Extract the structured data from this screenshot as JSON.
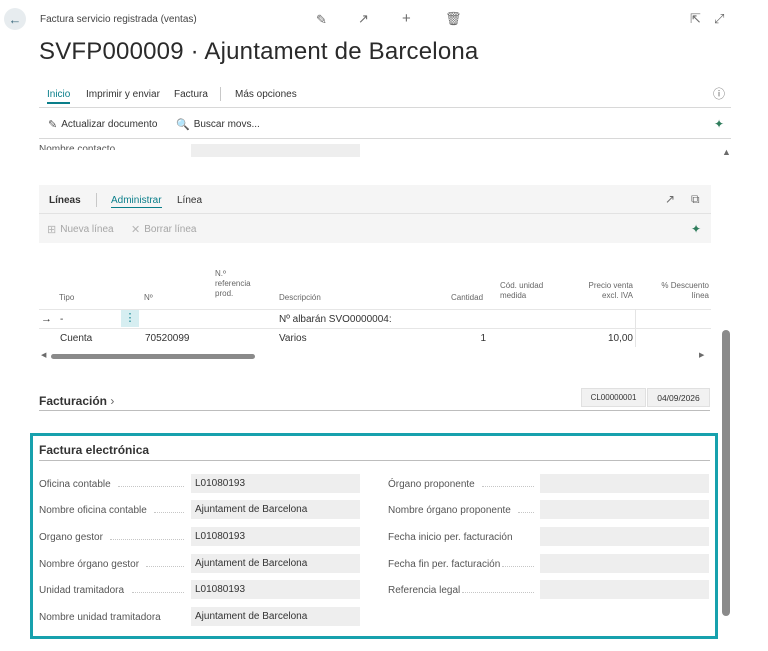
{
  "header": {
    "caption": "Factura servicio registrada (ventas)",
    "title": "SVFP000009 · Ajuntament de Barcelona"
  },
  "actionbar": {
    "tabs": [
      "Inicio",
      "Imprimir y enviar",
      "Factura",
      "Más opciones"
    ],
    "buttons": [
      "Actualizar documento",
      "Buscar movs..."
    ]
  },
  "contact": {
    "label": "Nombre contacto"
  },
  "lines": {
    "title": "Líneas",
    "tabs": [
      "Administrar",
      "Línea"
    ],
    "buttons": [
      "Nueva línea",
      "Borrar línea"
    ],
    "columns": [
      "Tipo",
      "Nº",
      "N.º referencia prod.",
      "Descripción",
      "Cantidad",
      "Cód. unidad medida",
      "Precio venta excl. IVA",
      "% Descuento línea"
    ],
    "rows": [
      {
        "tipo": "-",
        "no": "",
        "ref": "",
        "desc": "Nº albarán SVO0000004:",
        "qty": "",
        "unit": "",
        "price": ""
      },
      {
        "tipo": "Cuenta",
        "no": "70520099",
        "ref": "",
        "desc": "Varios",
        "qty": "1",
        "unit": "",
        "price": "10,00"
      }
    ]
  },
  "billing": {
    "title": "Facturación",
    "code": "CL00000001",
    "date": "04/09/2026"
  },
  "einvoice": {
    "title": "Factura electrónica",
    "left_fields": [
      {
        "label": "Oficina contable",
        "value": "L01080193"
      },
      {
        "label": "Nombre oficina contable",
        "value": "Ajuntament de Barcelona"
      },
      {
        "label": "Organo gestor",
        "value": "L01080193"
      },
      {
        "label": "Nombre órgano gestor",
        "value": "Ajuntament de Barcelona"
      },
      {
        "label": "Unidad tramitadora",
        "value": "L01080193"
      },
      {
        "label": "Nombre unidad tramitadora",
        "value": "Ajuntament de Barcelona"
      }
    ],
    "right_fields": [
      {
        "label": "Órgano proponente",
        "value": ""
      },
      {
        "label": "Nombre órgano proponente",
        "value": ""
      },
      {
        "label": "Fecha inicio per. facturación",
        "value": ""
      },
      {
        "label": "Fecha fin per. facturación",
        "value": ""
      },
      {
        "label": "Referencia legal",
        "value": ""
      }
    ]
  },
  "icons": [
    "back-arrow-icon",
    "edit-icon",
    "share-icon",
    "add-icon",
    "delete-icon",
    "open-new-window-icon",
    "expand-icon",
    "info-icon",
    "pin-icon",
    "collapse-up-icon"
  ]
}
